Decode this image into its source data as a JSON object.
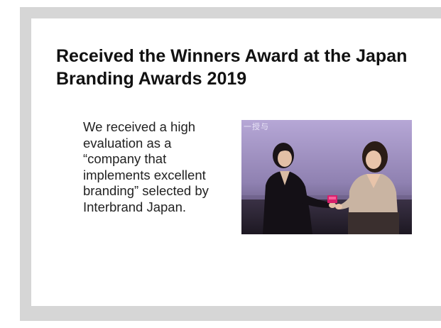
{
  "article": {
    "title": "Received the Winners Award at the Japan Branding Awards 2019",
    "body": "We received a high evaluation as a “company that implements excellent branding” selected by Interbrand Japan.",
    "photo_caption": "一授与"
  }
}
